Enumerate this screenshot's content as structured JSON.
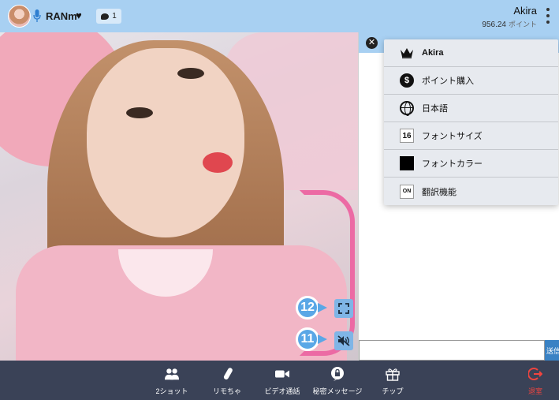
{
  "header": {
    "performer_name": "RANm",
    "viewer_count": "1",
    "user_name": "Akira",
    "points_value": "956.24",
    "points_unit": "ポイント"
  },
  "video": {
    "callout_fullscreen": "12",
    "callout_mute": "11"
  },
  "chat": {
    "send_label": "送信"
  },
  "menu": {
    "items": [
      {
        "label": "Akira",
        "icon": "crown-icon"
      },
      {
        "label": "ポイント購入",
        "icon": "dollar-coin-icon",
        "glyph": "$"
      },
      {
        "label": "日本語",
        "icon": "globe-icon"
      },
      {
        "label": "フォントサイズ",
        "icon": "font-size-icon",
        "glyph": "16"
      },
      {
        "label": "フォントカラー",
        "icon": "font-color-icon"
      },
      {
        "label": "翻訳機能",
        "icon": "translate-on-icon",
        "glyph": "ON"
      }
    ]
  },
  "toolbar": {
    "items": [
      {
        "label": "2ショット",
        "icon": "two-people-icon"
      },
      {
        "label": "リモちゃ",
        "icon": "remote-toy-icon"
      },
      {
        "label": "ビデオ通話",
        "icon": "video-camera-icon"
      },
      {
        "label": "秘密メッセージ",
        "icon": "lock-bubble-icon"
      },
      {
        "label": "チップ",
        "icon": "gift-icon"
      },
      {
        "label": "退室",
        "icon": "exit-icon"
      }
    ]
  },
  "colors": {
    "header_bg": "#a8d0f2",
    "toolbar_bg": "#3a4257",
    "menu_bg": "#e7eaef",
    "accent_blue": "#5aa7e6",
    "exit_red": "#f0443f"
  }
}
